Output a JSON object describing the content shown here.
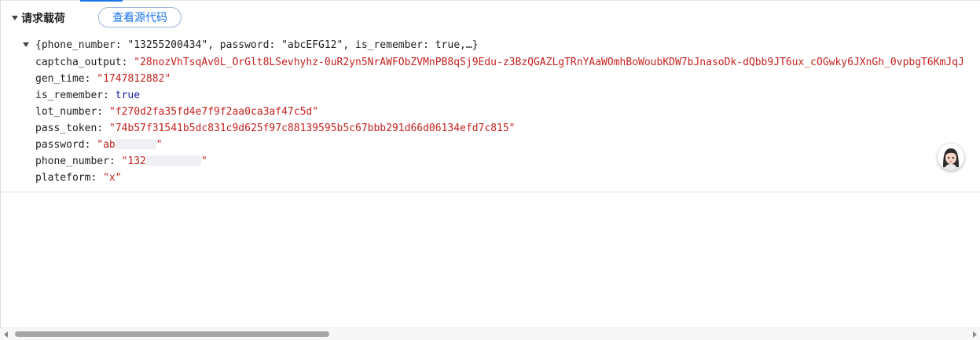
{
  "section": {
    "title": "请求载荷",
    "view_source_label": "查看源代码"
  },
  "payload": {
    "summary": "{phone_number: \"13255200434\", password: \"abcEFG12\", is_remember: true,…}",
    "properties": [
      {
        "key": "captcha_output",
        "value": "\"28nozVhTsqAv0L_OrGlt8LSevhyhz-0uR2yn5NrAWFObZVMnPB8qSj9Edu-z3BzQGAZLgTRnYAaWOmhBoWoubKDW7bJnasoDk-dQbb9JT6ux_cOGwky6JXnGh_0vpbgT6KmJqJ",
        "type": "string"
      },
      {
        "key": "gen_time",
        "value": "\"1747812882\"",
        "type": "string"
      },
      {
        "key": "is_remember",
        "value": "true",
        "type": "boolean"
      },
      {
        "key": "lot_number",
        "value": "\"f270d2fa35fd4e7f9f2aa0ca3af47c5d\"",
        "type": "string"
      },
      {
        "key": "pass_token",
        "value": "\"74b57f31541b5dc831c9d625f97c88139595b5c67bbb291d66d06134efd7c815\"",
        "type": "string"
      },
      {
        "key": "password",
        "value_visible": "\"ab",
        "value_end": "\"",
        "type": "string",
        "masked": true
      },
      {
        "key": "phone_number",
        "value_visible": "\"132",
        "value_end": "\"",
        "type": "string",
        "masked": true
      },
      {
        "key": "plateform",
        "value": "\"x\"",
        "type": "string"
      }
    ]
  },
  "icons": {
    "expand_section": "triangle-down-icon",
    "expand_payload": "triangle-down-icon",
    "scroll_left": "arrow-left-icon",
    "scroll_right": "arrow-right-icon",
    "assistant": "avatar-icon"
  },
  "colors": {
    "string": "#c5221f",
    "boolean": "#1a1aa6",
    "accent": "#1a73e8"
  }
}
